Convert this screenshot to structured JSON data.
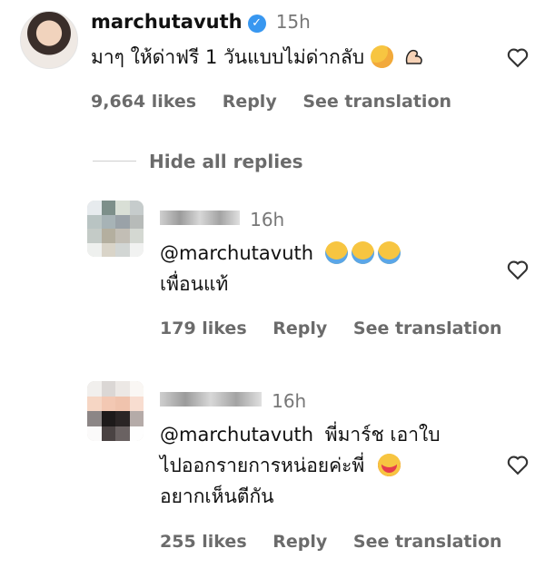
{
  "parent": {
    "username": "marchutavuth",
    "time": "15h",
    "text": "มาๆ ให้ด่าฟรี 1 วันแบบไม่ด่ากลับ",
    "likes": "9,664 likes",
    "reply": "Reply",
    "see_translation": "See translation",
    "emojis": [
      "smiling-face-with-hearts-icon",
      "flexed-biceps-icon"
    ]
  },
  "hide_replies": "Hide all replies",
  "replies": [
    {
      "time": "16h",
      "mention": "@marchutavuth",
      "text": "เพื่อนแท้",
      "likes": "179 likes",
      "reply": "Reply",
      "see_translation": "See translation",
      "emojis": [
        "face-with-tears-of-joy-icon",
        "face-with-tears-of-joy-icon",
        "face-with-tears-of-joy-icon"
      ]
    },
    {
      "time": "16h",
      "mention": "@marchutavuth",
      "text_line1": "พี่มาร์ช เอาใบ",
      "text_line2": "ไปออกรายการหน่อยค่ะพี่",
      "text_line3": "อยากเห็นตีกัน",
      "likes": "255 likes",
      "reply": "Reply",
      "see_translation": "See translation",
      "emojis": [
        "smiling-face-with-heart-eyes-icon"
      ]
    }
  ],
  "colors": {
    "verified": "#3897f0",
    "meta": "#6b6b6b",
    "time": "#777777"
  }
}
